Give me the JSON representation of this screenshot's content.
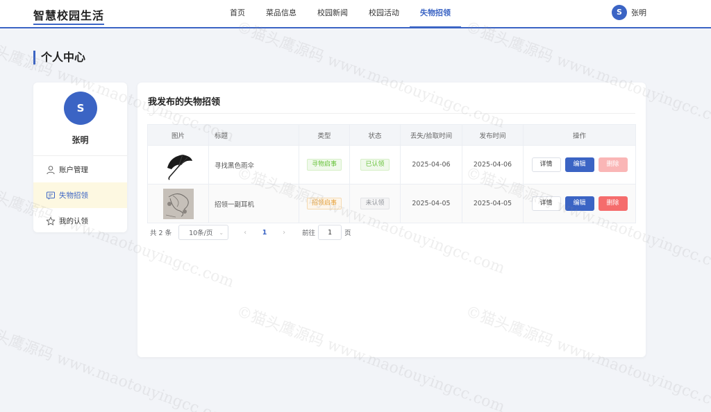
{
  "header": {
    "logo": "智慧校园生活",
    "nav": [
      {
        "label": "首页"
      },
      {
        "label": "菜品信息"
      },
      {
        "label": "校园新闻"
      },
      {
        "label": "校园活动"
      },
      {
        "label": "失物招领",
        "active": true
      }
    ],
    "user": {
      "initial": "S",
      "name": "张明"
    }
  },
  "page": {
    "title": "个人中心"
  },
  "sidebar": {
    "avatar_initial": "S",
    "name": "张明",
    "items": [
      {
        "label": "账户管理",
        "icon": "user-icon"
      },
      {
        "label": "失物招领",
        "icon": "message-icon",
        "active": true
      },
      {
        "label": "我的认领",
        "icon": "star-icon"
      }
    ]
  },
  "main": {
    "title": "我发布的失物招领",
    "columns": [
      "图片",
      "标题",
      "类型",
      "状态",
      "丢失/拾取时间",
      "发布时间",
      "操作"
    ],
    "rows": [
      {
        "image": "umbrella-photo",
        "title": "寻找黑色雨伞",
        "type": "寻物启事",
        "status": "已认领",
        "lost_time": "2025-04-06",
        "publish_time": "2025-04-06",
        "actions": {
          "detail": "详情",
          "edit": "编辑",
          "delete": "删除"
        }
      },
      {
        "image": "earphones-photo",
        "title": "招领一副耳机",
        "type": "招领启事",
        "status": "未认领",
        "lost_time": "2025-04-05",
        "publish_time": "2025-04-05",
        "actions": {
          "detail": "详情",
          "edit": "编辑",
          "delete": "删除"
        }
      }
    ],
    "pagination": {
      "total": "共 2 条",
      "page_size": "10条/页",
      "current": "1",
      "goto_label": "前往",
      "goto_value": "1",
      "page_unit": "页"
    }
  },
  "watermark": "©猫头鹰源码 www.maotouyingcc.com",
  "colors": {
    "primary": "#3b64c4",
    "danger": "#f56c6c",
    "success": "#67c23a",
    "warning": "#e6a23c"
  }
}
